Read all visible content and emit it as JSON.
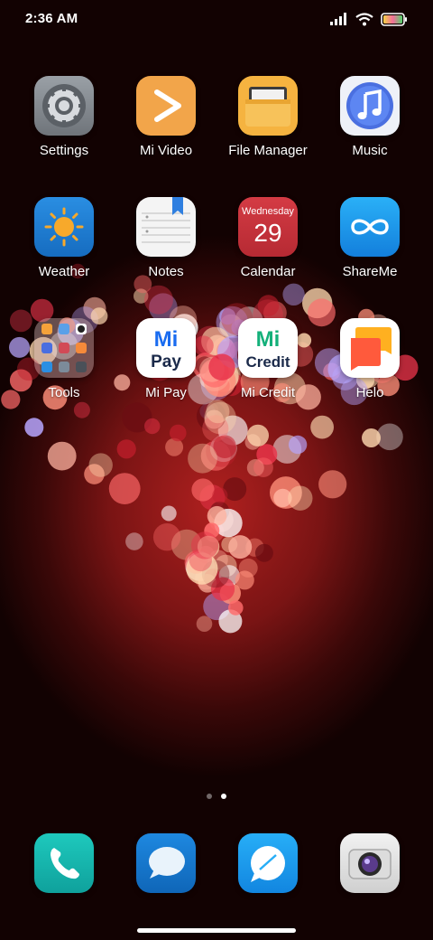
{
  "status_bar": {
    "time": "2:36 AM"
  },
  "home_apps": [
    {
      "label": "Settings",
      "icon": "gear-icon"
    },
    {
      "label": "Mi Video",
      "icon": "play-icon"
    },
    {
      "label": "File Manager",
      "icon": "folder-icon"
    },
    {
      "label": "Music",
      "icon": "music-note-icon"
    },
    {
      "label": "Weather",
      "icon": "sun-icon"
    },
    {
      "label": "Notes",
      "icon": "notepad-icon"
    },
    {
      "label": "Calendar",
      "icon": "calendar-icon",
      "weekday": "Wednesday",
      "day": "29"
    },
    {
      "label": "ShareMe",
      "icon": "infinity-icon"
    },
    {
      "label": "Tools",
      "icon": "folder-grid-icon"
    },
    {
      "label": "Mi Pay",
      "icon": "mi-pay-icon",
      "logo_top": "Mi",
      "logo_bottom": "Pay"
    },
    {
      "label": "Mi Credit",
      "icon": "mi-credit-icon",
      "logo_top": "Mi",
      "logo_bottom": "Credit"
    },
    {
      "label": "Helo",
      "icon": "chat-bubbles-icon"
    }
  ],
  "page_indicator": {
    "pages": 2,
    "active": 2
  },
  "dock": [
    {
      "name": "phone",
      "icon": "phone-icon"
    },
    {
      "name": "messages",
      "icon": "message-bubble-icon"
    },
    {
      "name": "browser",
      "icon": "browser-bubble-icon"
    },
    {
      "name": "camera",
      "icon": "camera-icon"
    }
  ],
  "colors": {
    "wallpaper_red": "#b0201f",
    "settings_bg": "#8a8d92",
    "mivideo_bg": "#f2a54a",
    "filemanager_bg": "#f5b340",
    "music_bg": "#eef1f8",
    "weather_bg": "#1f7fd6",
    "calendar_bg": "#c8323b",
    "shareme_bg": "#1e9cf0",
    "mi_pay_accent": "#1a6cf0",
    "mi_credit_accent": "#14b07a",
    "helo_bg": "#ffffff",
    "phone_bg": "#16b8b0",
    "messages_bg": "#1778d2",
    "browser_bg": "#1a9af0",
    "camera_bg": "#e6e6e6"
  }
}
